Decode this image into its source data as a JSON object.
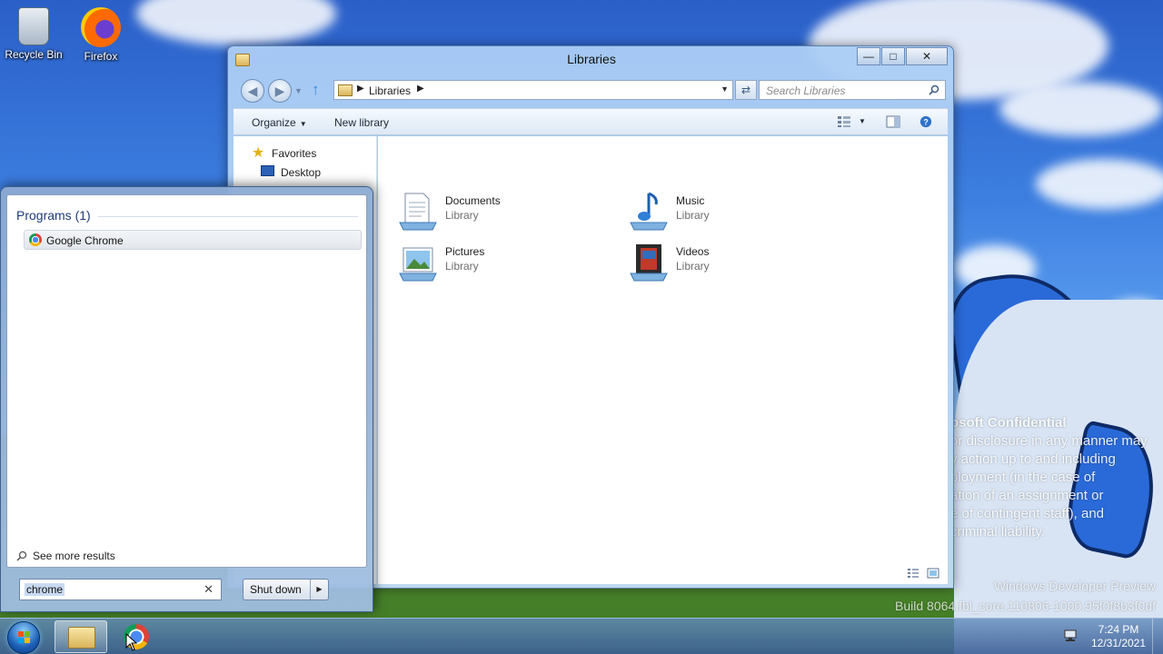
{
  "desktop": {
    "icons": [
      {
        "label": "Recycle Bin",
        "icon": "recycle-bin-icon"
      },
      {
        "label": "Firefox",
        "icon": "firefox-icon"
      }
    ],
    "watermark": {
      "lines": [
        "osoft Confidential",
        "or disclosure in any manner may",
        "y action up to and including",
        "ployment (in the case of",
        "ation of an assignment or",
        "e of contingent staff), and",
        "criminal liability."
      ],
      "edition": "Windows Developer Preview",
      "build": "Build 8064.fbl_core.110806-1000.95f0f8b3f0df"
    }
  },
  "explorer": {
    "title": "Libraries",
    "address": {
      "crumb": "Libraries"
    },
    "search_placeholder": "Search Libraries",
    "commands": {
      "organize": "Organize",
      "new_library": "New library"
    },
    "nav": {
      "favorites": "Favorites",
      "desktop": "Desktop"
    },
    "libraries": [
      {
        "name": "Documents",
        "type": "Library",
        "icon": "documents-library-icon"
      },
      {
        "name": "Music",
        "type": "Library",
        "icon": "music-library-icon"
      },
      {
        "name": "Pictures",
        "type": "Library",
        "icon": "pictures-library-icon"
      },
      {
        "name": "Videos",
        "type": "Library",
        "icon": "videos-library-icon"
      }
    ]
  },
  "start_menu": {
    "heading": "Programs (1)",
    "results": [
      {
        "label": "Google Chrome",
        "icon": "chrome-icon"
      }
    ],
    "see_more": "See more results",
    "search_value": "chrome",
    "shutdown": "Shut down"
  },
  "taskbar": {
    "apps": [
      {
        "name": "Windows Explorer",
        "icon": "folder-icon",
        "active": true
      },
      {
        "name": "Google Chrome",
        "icon": "chrome-icon",
        "active": false
      }
    ],
    "clock": {
      "time": "7:24 PM",
      "date": "12/31/2021"
    }
  },
  "colors": {
    "accent": "#2f8ae0",
    "taskbar": "#3c5f96",
    "heading": "#1e3c7a"
  }
}
